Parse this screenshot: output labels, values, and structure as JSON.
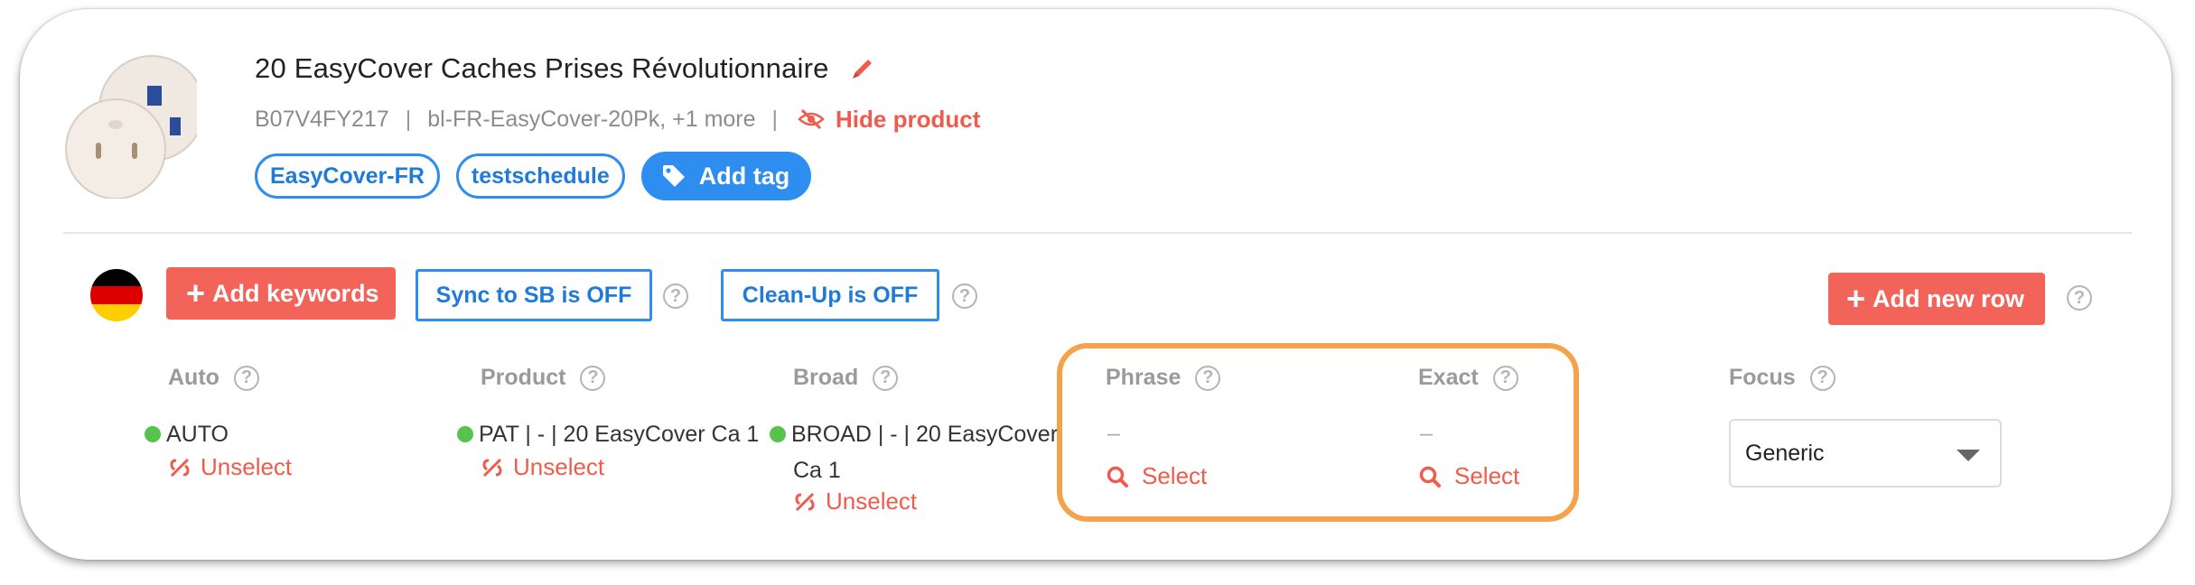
{
  "product": {
    "title": "20 EasyCover Caches Prises Révolutionnaire",
    "asin": "B07V4FY217",
    "sku": "bl-FR-EasyCover-20Pk, +1 more",
    "hide_label": "Hide product"
  },
  "tags": [
    "EasyCover-FR",
    "testschedule"
  ],
  "add_tag_label": "Add tag",
  "toolbar": {
    "add_keywords_label": "Add keywords",
    "sync_label": "Sync to SB is OFF",
    "cleanup_label": "Clean-Up is OFF",
    "add_row_label": "Add new row"
  },
  "columns": {
    "auto": {
      "header": "Auto",
      "value": "AUTO",
      "action": "Unselect"
    },
    "product": {
      "header": "Product",
      "value": "PAT | - | 20 EasyCover Ca 1",
      "action": "Unselect"
    },
    "broad": {
      "header": "Broad",
      "value_line1": "BROAD | - | 20 EasyCover",
      "value_line2": "Ca 1",
      "action": "Unselect"
    },
    "phrase": {
      "header": "Phrase",
      "value": "–",
      "action": "Select"
    },
    "exact": {
      "header": "Exact",
      "value": "–",
      "action": "Select"
    },
    "focus": {
      "header": "Focus",
      "selected": "Generic"
    }
  },
  "help_glyph": "?",
  "colors": {
    "accent_red": "#f2645a",
    "accent_blue": "#2d8ef0",
    "status_green": "#57c34d",
    "highlight_orange": "#f5a34a"
  }
}
